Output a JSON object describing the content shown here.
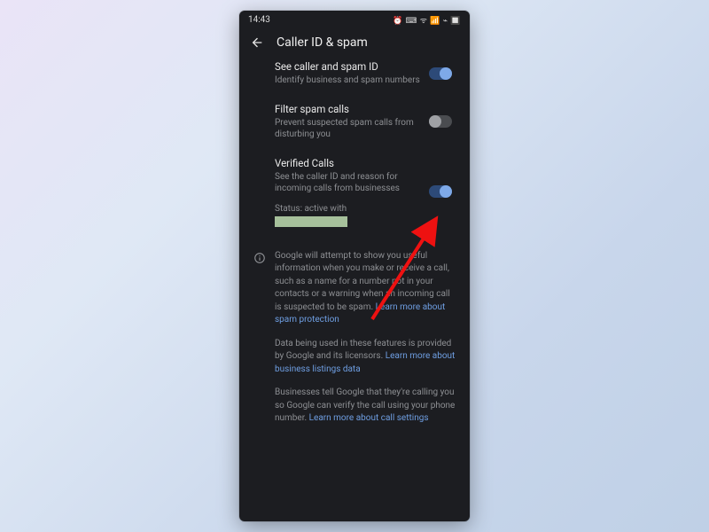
{
  "statusbar": {
    "time": "14:43",
    "icons": "⏰ ⌨ ᯤ 📶 ⌁ 🔲"
  },
  "appbar": {
    "title": "Caller ID & spam"
  },
  "settings": {
    "see_caller": {
      "title": "See caller and spam ID",
      "sub": "Identify business and spam numbers",
      "on": true
    },
    "filter": {
      "title": "Filter spam calls",
      "sub": "Prevent suspected spam calls from disturbing you",
      "on": false
    },
    "verified": {
      "title": "Verified Calls",
      "sub": "See the caller ID and reason for incoming calls from businesses",
      "status_label": "Status: active with",
      "on": true
    }
  },
  "info": {
    "p1": "Google will attempt to show you useful information when you make or receive a call, such as a name for a number not in your contacts or a warning when an incoming call is suspected to be spam. ",
    "p1_link": "Learn more about spam protection",
    "p2a": "Data being used in these features is provided by Google and its licensors. ",
    "p2_link": "Learn more about business listings data",
    "p3a": "Businesses tell Google that they're calling you so Google can verify the call using your phone number. ",
    "p3_link": "Learn more about call settings"
  }
}
